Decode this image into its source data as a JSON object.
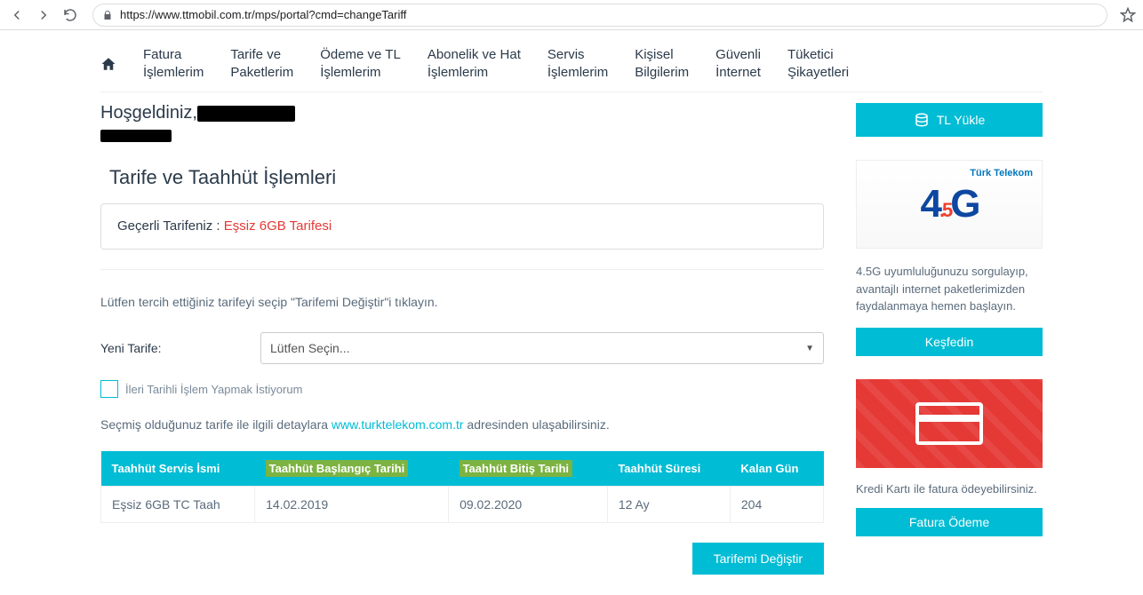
{
  "browser": {
    "url": "https://www.ttmobil.com.tr/mps/portal?cmd=changeTariff"
  },
  "nav": {
    "items": [
      "Fatura\nİşlemlerim",
      "Tarife ve\nPaketlerim",
      "Ödeme ve TL\nİşlemlerim",
      "Abonelik ve Hat\nİşlemlerim",
      "Servis\nİşlemlerim",
      "Kişisel\nBilgilerim",
      "Güvenli\nİnternet",
      "Tüketici\nŞikayetleri"
    ]
  },
  "welcome_prefix": "Hoşgeldiniz,",
  "section_title": "Tarife ve Taahhüt İşlemleri",
  "current_tariff": {
    "label": "Geçerli Tarifeniz : ",
    "name": "Eşsiz 6GB Tarifesi"
  },
  "instruction": "Lütfen tercih ettiğiniz tarifeyi seçip \"Tarifemi Değiştir\"i tıklayın.",
  "form": {
    "new_tariff_label": "Yeni Tarife:",
    "select_placeholder": "Lütfen Seçin...",
    "future_date_label": "İleri Tarihli İşlem Yapmak İstiyorum"
  },
  "details_text_pre": "Seçmiş olduğunuz tarife ile ilgili detaylara  ",
  "details_link": "www.turktelekom.com.tr",
  "details_text_post": "  adresinden ulaşabilirsiniz.",
  "table": {
    "headers": [
      "Taahhüt Servis İsmi",
      "Taahhüt Başlangıç Tarihi",
      "Taahhüt Bitiş Tarihi",
      "Taahhüt Süresi",
      "Kalan Gün"
    ],
    "row": [
      "Eşsiz 6GB TC Taah",
      "14.02.2019",
      "09.02.2020",
      "12 Ay",
      "204"
    ]
  },
  "change_button": "Tarifemi Değiştir",
  "sidebar": {
    "tl_button": "TL Yükle",
    "promo1_brand": "Türk Telekom",
    "promo1_desc": "4.5G uyumluluğunuzu sorgulayıp, avantajlı internet paketlerimizden faydalanmaya hemen başlayın.",
    "promo1_button": "Keşfedin",
    "promo2_desc": "Kredi Kartı ile fatura ödeyebilirsiniz.",
    "promo2_button": "Fatura Ödeme"
  }
}
